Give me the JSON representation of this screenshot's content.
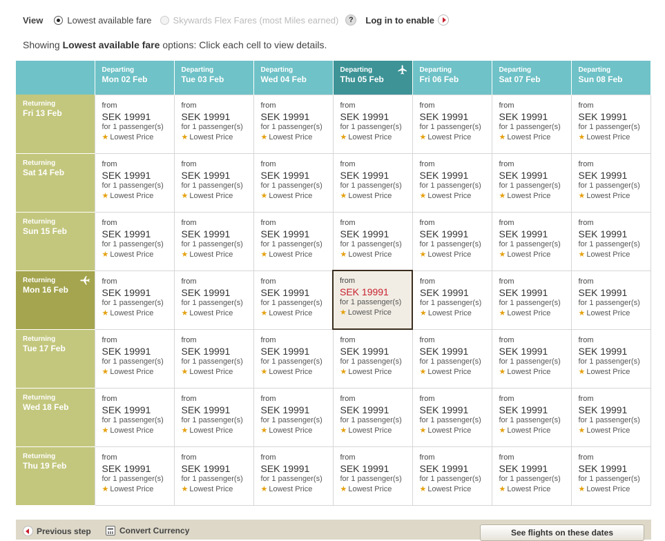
{
  "view": {
    "label": "View",
    "option_lowest": "Lowest available fare",
    "option_flex": "Skywards Flex Fares (most Miles earned)",
    "help": "?",
    "login": "Log in to enable"
  },
  "showing": {
    "prefix": "Showing ",
    "bold": "Lowest available fare",
    "suffix": " options: Click each cell to view details."
  },
  "departing_label": "Departing",
  "returning_label": "Returning",
  "departures": [
    "Mon 02 Feb",
    "Tue 03 Feb",
    "Wed 04 Feb",
    "Thu 05 Feb",
    "Fri 06 Feb",
    "Sat 07 Feb",
    "Sun 08 Feb"
  ],
  "returns": [
    "Fri 13 Feb",
    "Sat 14 Feb",
    "Sun 15 Feb",
    "Mon 16 Feb",
    "Tue 17 Feb",
    "Wed 18 Feb",
    "Thu 19 Feb"
  ],
  "selected": {
    "departure_index": 3,
    "return_index": 3
  },
  "fare": {
    "from": "from",
    "price": "SEK 19991",
    "passengers": "for 1 passenger(s)",
    "tag": "Lowest Price"
  },
  "footer": {
    "previous": "Previous step",
    "convert": "Convert Currency",
    "see_flights": "See flights on these dates"
  },
  "colors": {
    "departing_header": "#6fc2c7",
    "departing_selected": "#3d9396",
    "returning_header": "#c3c77d",
    "returning_selected": "#a4a54e",
    "selected_price": "#c8202f",
    "star": "#e5a00d"
  }
}
